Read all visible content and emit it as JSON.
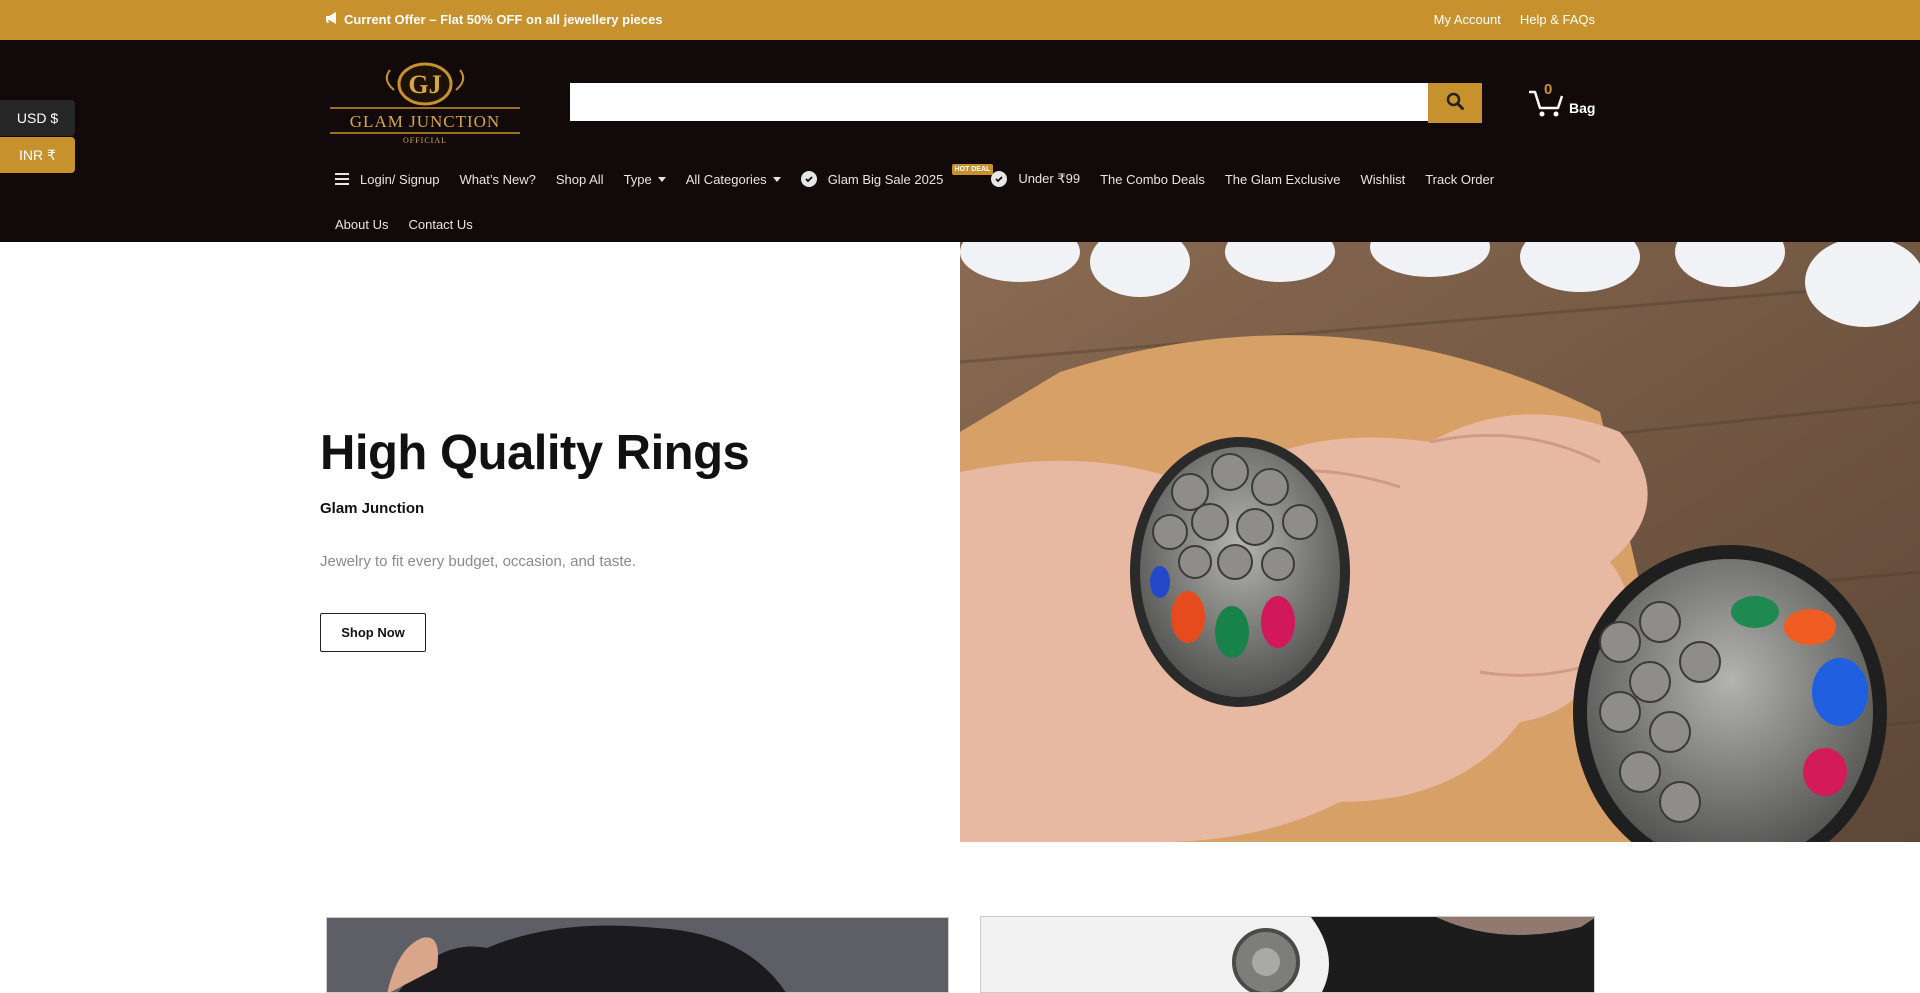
{
  "topbar": {
    "offer_text": "Current Offer – Flat 50% OFF on all jewellery pieces",
    "links": [
      "My Account",
      "Help & FAQs"
    ]
  },
  "header": {
    "logo": {
      "monogram": "GJ",
      "name": "GLAM JUNCTION",
      "tagline": "OFFICIAL"
    },
    "search": {
      "placeholder": ""
    },
    "cart": {
      "count": "0",
      "label": "Bag"
    }
  },
  "nav": {
    "row1": [
      {
        "label": "Login/ Signup",
        "icon": "menu-icon"
      },
      {
        "label": "What’s New?"
      },
      {
        "label": "Shop All"
      },
      {
        "label": "Type",
        "dropdown": true
      },
      {
        "label": "All Categories",
        "dropdown": true
      },
      {
        "label": "Glam Big Sale 2025",
        "icon": "check-circle-icon",
        "badge": "HOT DEAL"
      },
      {
        "label": "Under ₹99",
        "icon": "check-circle-icon"
      },
      {
        "label": "The Combo Deals"
      },
      {
        "label": "The Glam Exclusive"
      },
      {
        "label": "Wishlist"
      },
      {
        "label": "Track Order"
      }
    ],
    "row2": [
      {
        "label": "About Us"
      },
      {
        "label": "Contact Us"
      }
    ]
  },
  "currency": {
    "usd": "USD $",
    "inr": "INR ₹",
    "selected": "INR ₹"
  },
  "hero": {
    "title": "High Quality Rings",
    "subtitle": "Glam Junction",
    "description": "Jewelry to fit every budget, occasion, and taste.",
    "button": "Shop Now"
  },
  "colors": {
    "accent": "#c7922e",
    "header_bg": "#120a0a",
    "text": "#111111"
  }
}
